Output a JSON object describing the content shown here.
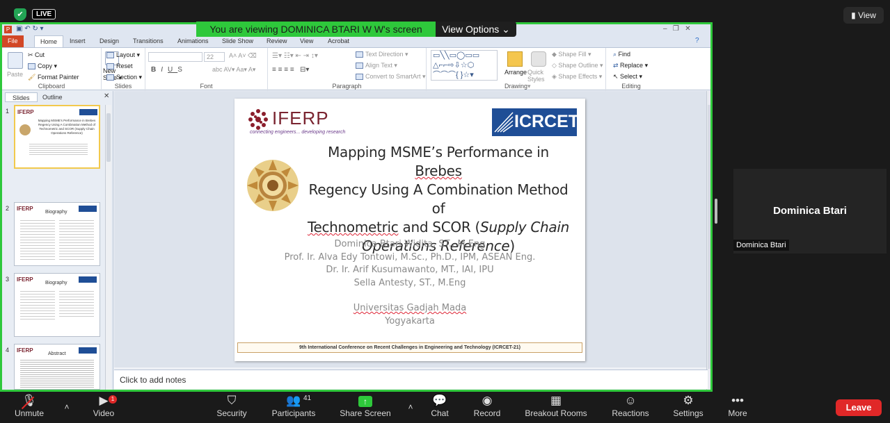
{
  "top": {
    "live": "LIVE",
    "view": "View",
    "shield": "✔"
  },
  "banner": {
    "text": "You are viewing DOMINICA BTARI W W's screen",
    "options": "View Options ⌄"
  },
  "ppt": {
    "tabs": [
      "File",
      "Home",
      "Insert",
      "Design",
      "Transitions",
      "Animations",
      "Slide Show",
      "Review",
      "View",
      "Acrobat"
    ],
    "clipboard": {
      "paste": "Paste",
      "cut": "Cut",
      "copy": "Copy ▾",
      "painter": "Format Painter",
      "label": "Clipboard"
    },
    "slides": {
      "new": "New Slide ▾",
      "layout": "Layout ▾",
      "reset": "Reset",
      "section": "Section ▾",
      "label": "Slides"
    },
    "font": {
      "size": "22",
      "label": "Font"
    },
    "paragraph": {
      "dir": "Text Direction ▾",
      "align": "Align Text ▾",
      "smart": "Convert to SmartArt ▾",
      "label": "Paragraph"
    },
    "drawing": {
      "arrange": "Arrange",
      "quick": "Quick Styles ▾",
      "fill": "Shape Fill ▾",
      "outline": "Shape Outline ▾",
      "effects": "Shape Effects ▾",
      "label": "Drawing"
    },
    "editing": {
      "find": "Find",
      "replace": "Replace ▾",
      "select": "Select ▾",
      "label": "Editing"
    },
    "pane": {
      "slides": "Slides",
      "outline": "Outline",
      "close": "✕"
    },
    "thumbs": [
      {
        "n": "1",
        "title": "Mapping MSME's Performance in Brebes Regency Using A Combination Method of Technometric and SCOR (Supply Chain Operations Reference)"
      },
      {
        "n": "2",
        "title": "Biography"
      },
      {
        "n": "3",
        "title": "Biography"
      },
      {
        "n": "4",
        "title": "Abstract"
      }
    ],
    "notes": "Click to add notes"
  },
  "slide": {
    "logo_left": "IFERP",
    "logo_left_sub": "connecting engineers... developing research",
    "logo_right": "ICRCET",
    "title_l1a": "Mapping MSME’s Performance in ",
    "title_l1b": "Brebes",
    "title_l2": "Regency Using A Combination Method of",
    "title_l3a": "Technometric",
    "title_l3b": " and SCOR (",
    "title_l3c": "Supply Chain",
    "title_l4a": "Operations Reference",
    "title_l4b": ")",
    "a1": "Dominica Btari Widita, ST., M.Eng",
    "a2": "Prof. Ir. Alva Edy Tontowi, M.Sc., Ph.D., IPM, ASEAN Eng.",
    "a3": "Dr. Ir. Arif Kusumawanto, MT., IAI, IPU",
    "a4": "Sella Antesty, ST., M.Eng",
    "uni": "Universitas Gadjah Mada",
    "city": "Yogyakarta",
    "footer": "9th International Conference on Recent Challenges in Engineering and Technology  (ICRCET-21)"
  },
  "tile": {
    "name": "Dominica Btari",
    "label": "Dominica Btari"
  },
  "toolbar": {
    "unmute": "Unmute",
    "video": "Video",
    "video_badge": "1",
    "security": "Security",
    "participants": "Participants",
    "participants_count": "41",
    "share": "Share Screen",
    "chat": "Chat",
    "record": "Record",
    "breakout": "Breakout Rooms",
    "reactions": "Reactions",
    "settings": "Settings",
    "more": "More",
    "leave": "Leave"
  }
}
